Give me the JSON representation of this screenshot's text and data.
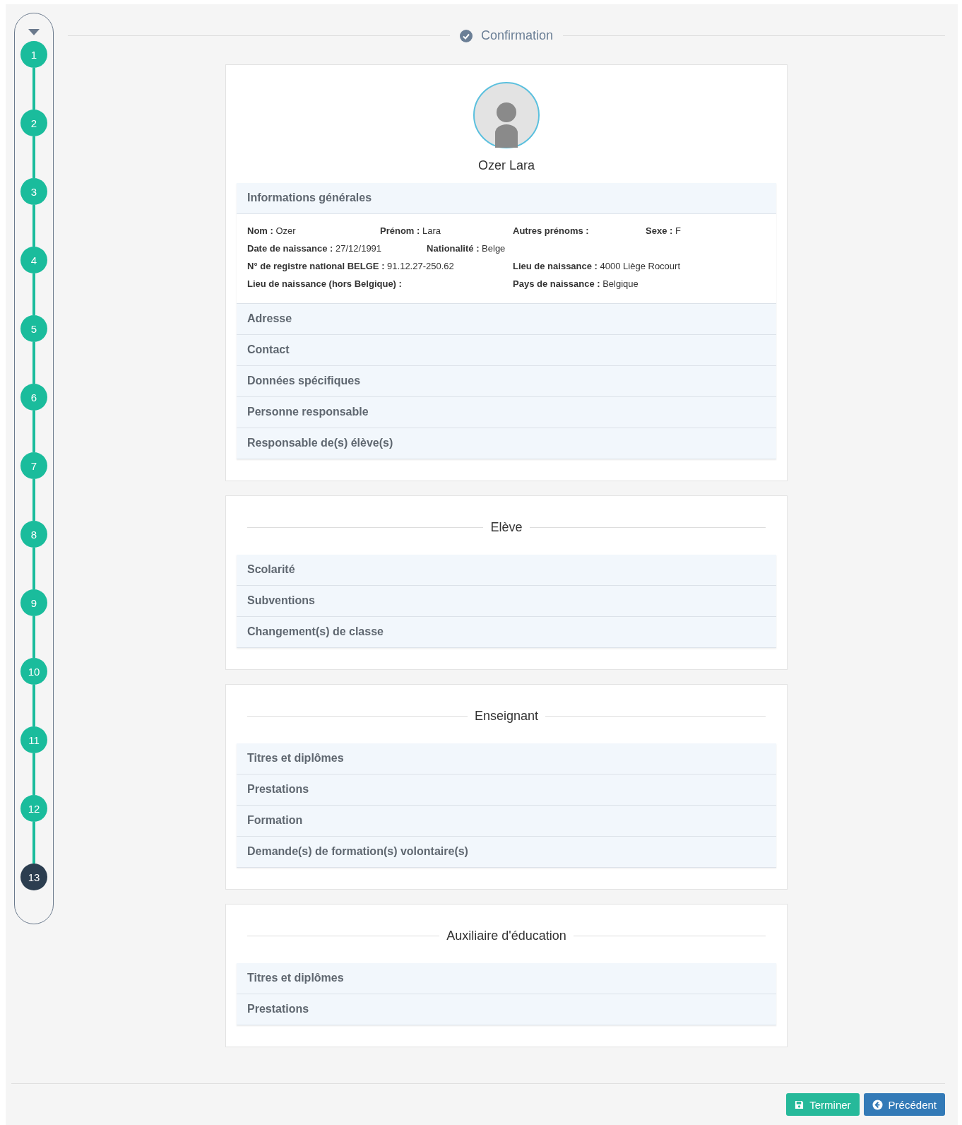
{
  "steps": [
    {
      "label": "1",
      "selected": false
    },
    {
      "label": "2",
      "selected": false
    },
    {
      "label": "3",
      "selected": false
    },
    {
      "label": "4",
      "selected": false
    },
    {
      "label": "5",
      "selected": false
    },
    {
      "label": "6",
      "selected": false
    },
    {
      "label": "7",
      "selected": false
    },
    {
      "label": "8",
      "selected": false
    },
    {
      "label": "9",
      "selected": false
    },
    {
      "label": "10",
      "selected": false
    },
    {
      "label": "11",
      "selected": false
    },
    {
      "label": "12",
      "selected": false
    },
    {
      "label": "13",
      "selected": true
    }
  ],
  "header": {
    "title": "Confirmation"
  },
  "profile": {
    "name": "Ozer Lara"
  },
  "cards": [
    {
      "sections": [
        {
          "label": "Informations générales",
          "rows": [
            {
              "kind": "grid",
              "fields": [
                {
                  "label": "Nom :",
                  "value": "Ozer"
                },
                {
                  "label": "Prénom :",
                  "value": "Lara"
                },
                {
                  "label": "Autres prénoms :"
                },
                {
                  "label": "Sexe :",
                  "value": "F"
                }
              ]
            },
            {
              "kind": "inline",
              "fields": [
                {
                  "label": "Date de naissance :",
                  "value": "27/12/1991"
                },
                {
                  "label": "Nationalité :",
                  "value": "Belge"
                }
              ]
            },
            {
              "kind": "grid",
              "fields": [
                {
                  "label": "N° de registre national BELGE :",
                  "value": "91.12.27-250.62"
                },
                {
                  "label": "Lieu de naissance :",
                  "value": "4000 Liège Rocourt"
                }
              ]
            },
            {
              "kind": "grid",
              "fields": [
                {
                  "label": "Lieu de naissance (hors Belgique) :"
                },
                {
                  "label": "Pays de naissance :",
                  "value": "Belgique"
                }
              ]
            }
          ]
        },
        {
          "label": "Adresse"
        },
        {
          "label": "Contact"
        },
        {
          "label": "Données spécifiques"
        },
        {
          "label": "Personne responsable"
        },
        {
          "label": "Responsable de(s) élève(s)"
        }
      ]
    },
    {
      "title": "Elève",
      "sections": [
        {
          "label": "Scolarité"
        },
        {
          "label": "Subventions"
        },
        {
          "label": "Changement(s) de classe"
        }
      ]
    },
    {
      "title": "Enseignant",
      "sections": [
        {
          "label": "Titres et diplômes"
        },
        {
          "label": "Prestations"
        },
        {
          "label": "Formation"
        },
        {
          "label": "Demande(s) de formation(s) volontaire(s)"
        }
      ]
    },
    {
      "title": "Auxiliaire d'éducation",
      "sections": [
        {
          "label": "Titres et diplômes"
        },
        {
          "label": "Prestations"
        }
      ]
    }
  ],
  "buttons": [
    {
      "kind": "finish",
      "label": "Terminer"
    },
    {
      "kind": "previous",
      "label": "Précédent"
    }
  ]
}
